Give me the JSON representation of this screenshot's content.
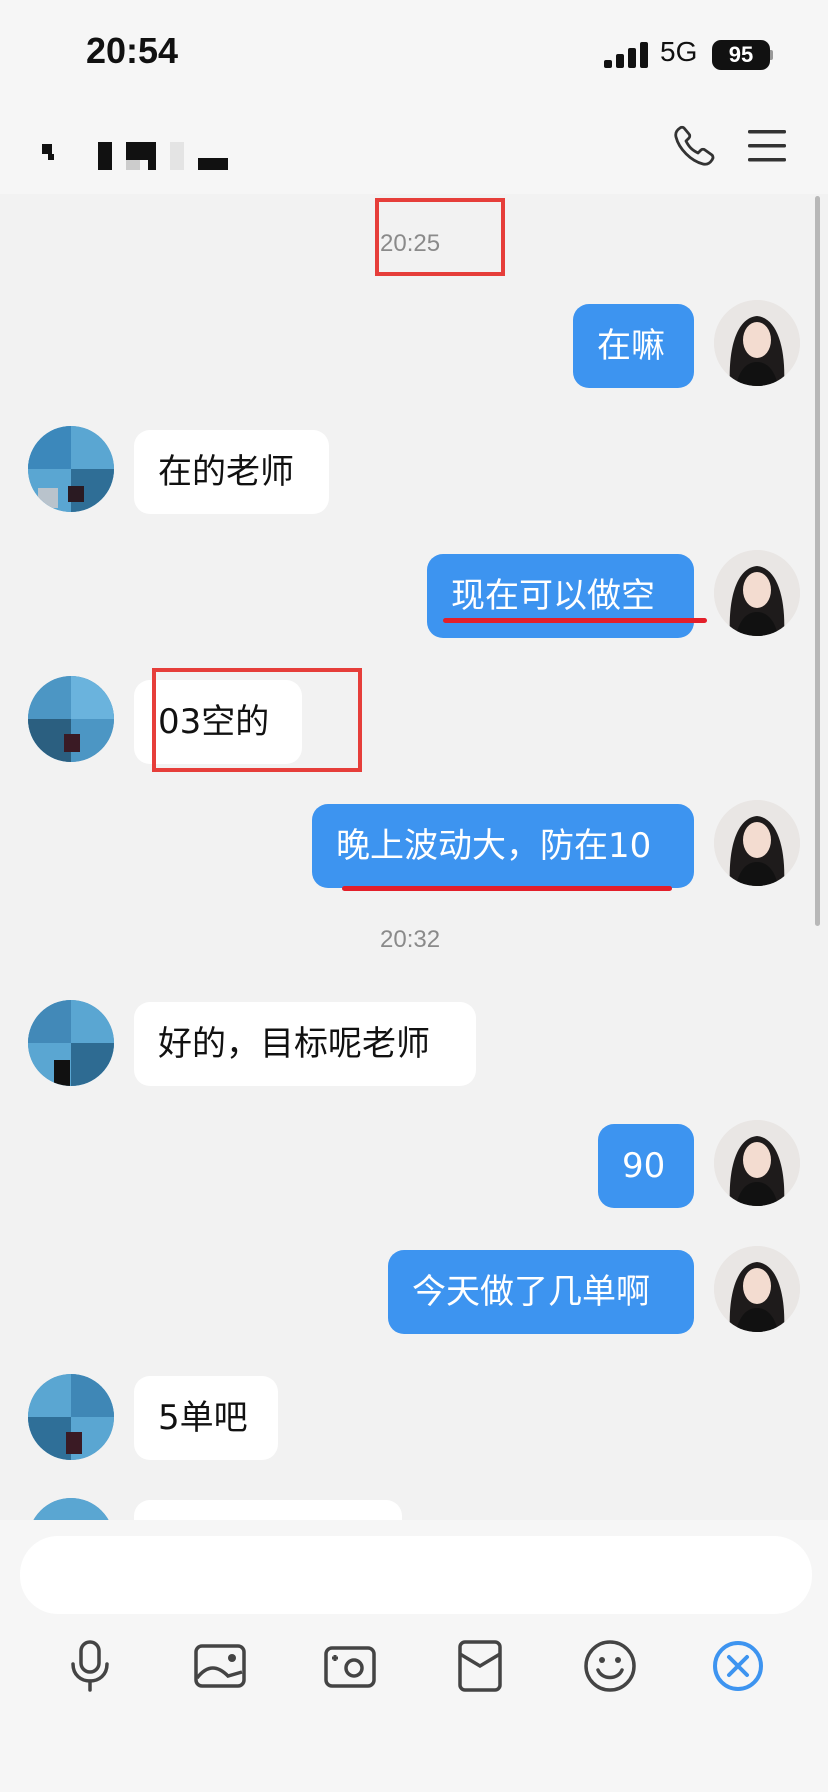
{
  "status_bar": {
    "time": "20:54",
    "network": "5G",
    "battery": "95"
  },
  "nav": {
    "call_icon": "phone-icon",
    "menu_icon": "hamburger-menu-icon"
  },
  "messages": [
    {
      "type": "time",
      "text": "20:25"
    },
    {
      "type": "out",
      "text": "在嘛"
    },
    {
      "type": "in",
      "text": "在的老师"
    },
    {
      "type": "out",
      "text": "现在可以做空"
    },
    {
      "type": "in",
      "text": "03空的"
    },
    {
      "type": "out",
      "text": "晚上波动大，防在10"
    },
    {
      "type": "time",
      "text": "20:32"
    },
    {
      "type": "in",
      "text": "好的，目标呢老师"
    },
    {
      "type": "out",
      "text": "90"
    },
    {
      "type": "out",
      "text": "今天做了几单啊"
    },
    {
      "type": "in",
      "text": "5单吧"
    }
  ],
  "input": {
    "placeholder": ""
  },
  "toolbar": {
    "icons": [
      "microphone-icon",
      "image-icon",
      "camera-icon",
      "red-packet-icon",
      "emoji-icon",
      "close-icon"
    ]
  },
  "colors": {
    "outgoing_bubble": "#3d94f0",
    "incoming_bubble": "#ffffff",
    "annotation_red": "#e63e3a",
    "accent_blue": "#3d94f0"
  }
}
